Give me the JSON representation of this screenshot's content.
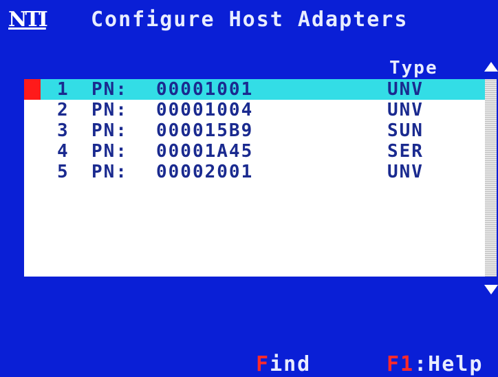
{
  "header": {
    "logo_text": "NTI",
    "title": "Configure Host Adapters"
  },
  "list": {
    "type_column_header": "Type",
    "selected_index": 0,
    "rows": [
      {
        "number": "1",
        "pn_label": "PN:",
        "pn": "00001001",
        "type": "UNV"
      },
      {
        "number": "2",
        "pn_label": "PN:",
        "pn": "00001004",
        "type": "UNV"
      },
      {
        "number": "3",
        "pn_label": "PN:",
        "pn": "000015B9",
        "type": "SUN"
      },
      {
        "number": "4",
        "pn_label": "PN:",
        "pn": "00001A45",
        "type": "SER"
      },
      {
        "number": "5",
        "pn_label": "PN:",
        "pn": "00002001",
        "type": "UNV"
      }
    ]
  },
  "footer": {
    "find_hotkey": "F",
    "find_label": "ind",
    "help_hotkey": "F1",
    "help_label": ":Help"
  },
  "colors": {
    "background": "#0a1fd6",
    "list_background": "#ffffff",
    "selected_row": "#33dde6",
    "selection_marker": "#ff1a1a",
    "hotkey": "#ff2a2a",
    "row_text": "#1a2a8f"
  }
}
